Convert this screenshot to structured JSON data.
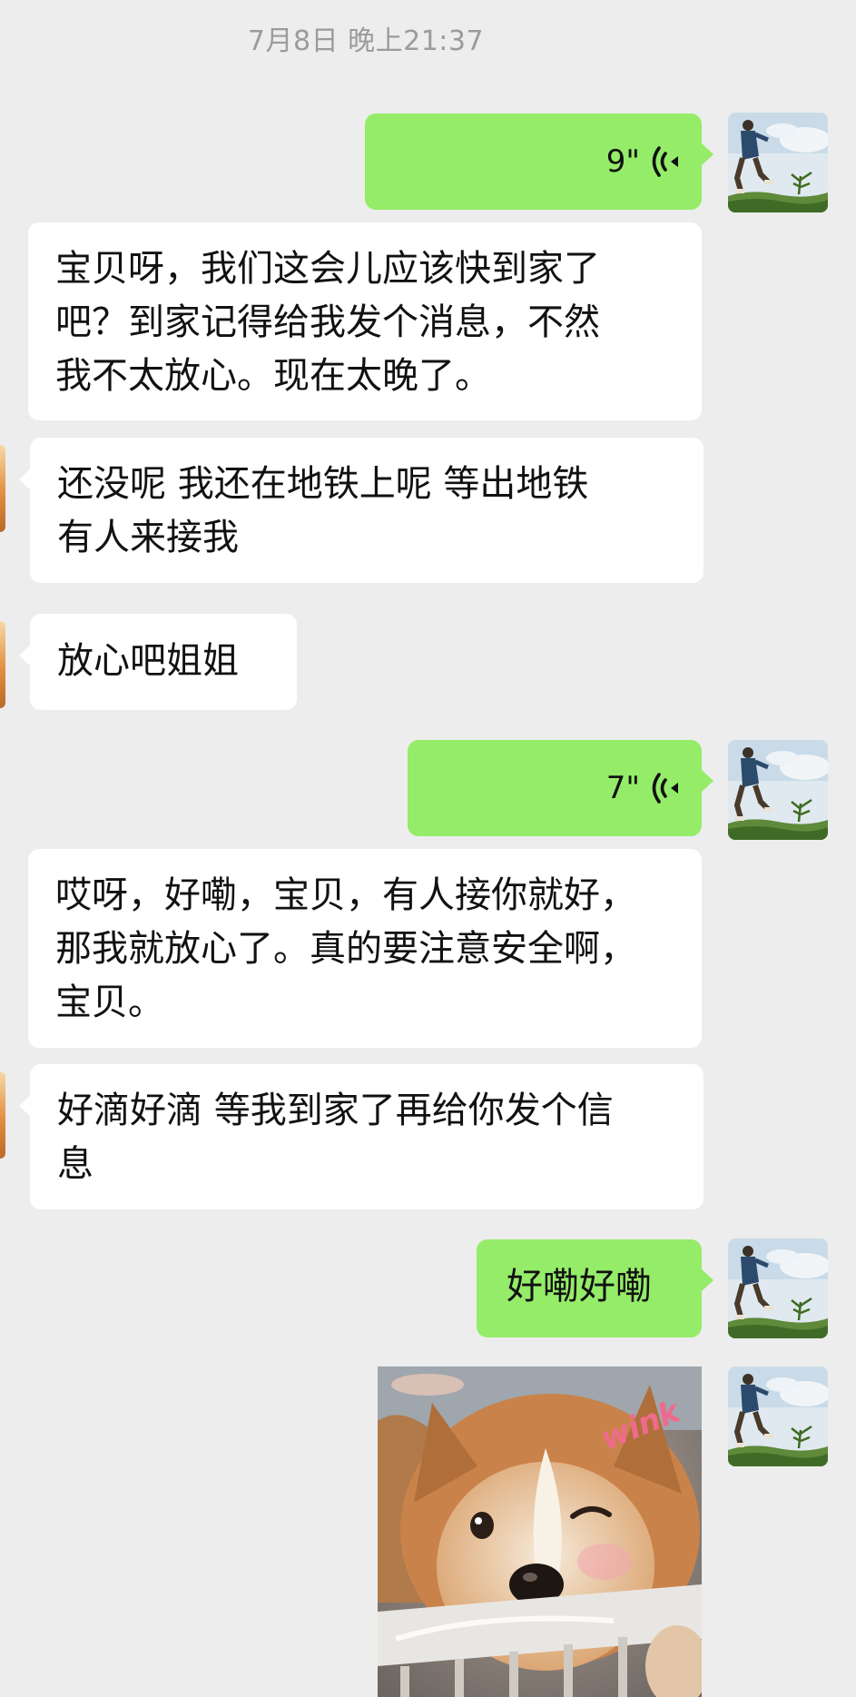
{
  "timestamp": "7月8日 晚上21:37",
  "messages": [
    {
      "type": "voice",
      "side": "out",
      "duration": "9\""
    },
    {
      "type": "text",
      "side": "in",
      "lines": [
        "宝贝呀，我们这会儿应该快到家了",
        "吧？到家记得给我发个消息，不然",
        "我不太放心。现在太晚了。"
      ]
    },
    {
      "type": "text",
      "side": "in",
      "lines": [
        "还没呢 我还在地铁上呢 等出地铁",
        "有人来接我"
      ]
    },
    {
      "type": "text",
      "side": "in",
      "lines": [
        "放心吧姐姐"
      ]
    },
    {
      "type": "voice",
      "side": "out",
      "duration": "7\""
    },
    {
      "type": "text",
      "side": "in",
      "lines": [
        "哎呀，好嘞，宝贝，有人接你就好，",
        "那我就放心了。真的要注意安全啊，",
        "宝贝。"
      ]
    },
    {
      "type": "text",
      "side": "in",
      "lines": [
        "好滴好滴 等我到家了再给你发个信",
        "息"
      ]
    },
    {
      "type": "text",
      "side": "out",
      "lines": [
        "好嘞好嘞"
      ]
    },
    {
      "type": "sticker",
      "side": "out",
      "caption": "wink"
    }
  ],
  "colors": {
    "background": "#ededed",
    "outgoing_bubble": "#95ec69",
    "incoming_bubble": "#ffffff",
    "timestamp_text": "#9b9b9b"
  },
  "icons": {
    "voice": "voice-wave-icon",
    "avatar": "avatar-person-jumping"
  }
}
